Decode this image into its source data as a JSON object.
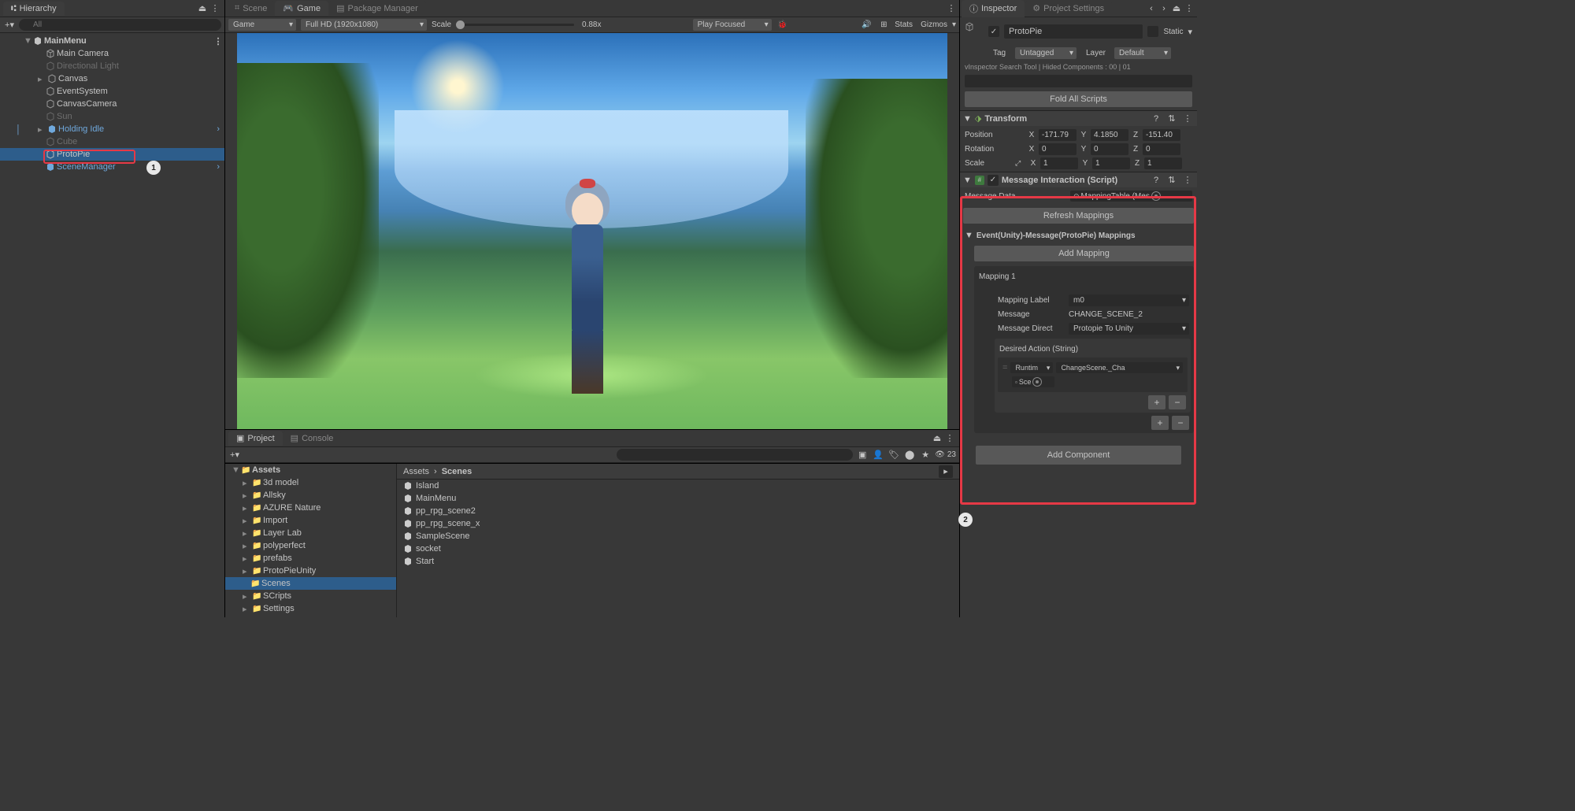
{
  "hierarchy": {
    "title": "Hierarchy",
    "search_placeholder": "All",
    "root": "MainMenu",
    "items": [
      {
        "name": "Main Camera",
        "indent": 2
      },
      {
        "name": "Directional Light",
        "indent": 2,
        "dim": true
      },
      {
        "name": "Canvas",
        "indent": 2,
        "fold": true
      },
      {
        "name": "EventSystem",
        "indent": 2
      },
      {
        "name": "CanvasCamera",
        "indent": 2
      },
      {
        "name": "Sun",
        "indent": 2,
        "dim": true
      },
      {
        "name": "Holding Idle",
        "indent": 2,
        "fold": true,
        "blue": true,
        "arrow": true
      },
      {
        "name": "Cube",
        "indent": 2,
        "dim": true
      },
      {
        "name": "ProtoPie",
        "indent": 2,
        "sel": true
      },
      {
        "name": "SceneManager",
        "indent": 2,
        "blue": true,
        "arrow": true
      }
    ]
  },
  "game": {
    "tabs": {
      "scene": "Scene",
      "game": "Game",
      "pkg": "Package Manager"
    },
    "display": "Game",
    "res": "Full HD (1920x1080)",
    "scale_label": "Scale",
    "scale_val": "0.88x",
    "play": "Play Focused",
    "stats": "Stats",
    "gizmos": "Gizmos"
  },
  "project": {
    "tab_project": "Project",
    "tab_console": "Console",
    "root": "Assets",
    "folders": [
      "3d model",
      "Allsky",
      "AZURE Nature",
      "Import",
      "Layer Lab",
      "polyperfect",
      "prefabs",
      "ProtoPieUnity",
      "Scenes",
      "SCripts",
      "Settings"
    ],
    "selected": "Scenes",
    "breadcrumb": {
      "root": "Assets",
      "current": "Scenes"
    },
    "assets": [
      "Island",
      "MainMenu",
      "pp_rpg_scene2",
      "pp_rpg_scene_x",
      "SampleScene",
      "socket",
      "Start"
    ],
    "visible_count": "23"
  },
  "inspector": {
    "tab_inspector": "Inspector",
    "tab_settings": "Project Settings",
    "obj_name": "ProtoPie",
    "static_label": "Static",
    "tag_label": "Tag",
    "tag_value": "Untagged",
    "layer_label": "Layer",
    "layer_value": "Default",
    "search_info": "vInspector Search Tool | Hided Components : 00 | 01",
    "fold_btn": "Fold All Scripts",
    "transform": {
      "title": "Transform",
      "pos_label": "Position",
      "px": "-171.79",
      "py": "4.1850",
      "pz": "-151.40",
      "rot_label": "Rotation",
      "rx": "0",
      "ry": "0",
      "rz": "0",
      "scl_label": "Scale",
      "sx": "1",
      "sy": "1",
      "sz": "1"
    },
    "script": {
      "title": "Message Interaction (Script)",
      "msg_data_label": "Message Data",
      "msg_data_val": "MappingTable (Mes",
      "refresh_btn": "Refresh Mappings",
      "mappings_title": "Event(Unity)-Message(ProtoPie) Mappings",
      "add_mapping": "Add Mapping",
      "mapping1": "Mapping 1",
      "label_label": "Mapping Label",
      "label_val": "m0",
      "msg_label": "Message",
      "msg_val": "CHANGE_SCENE_2",
      "dir_label": "Message Direct",
      "dir_val": "Protopie To Unity",
      "action_label": "Desired Action (String)",
      "runtime": "Runtim",
      "func": "ChangeScene._Cha",
      "target": "Sce"
    },
    "add_comp": "Add Component"
  }
}
